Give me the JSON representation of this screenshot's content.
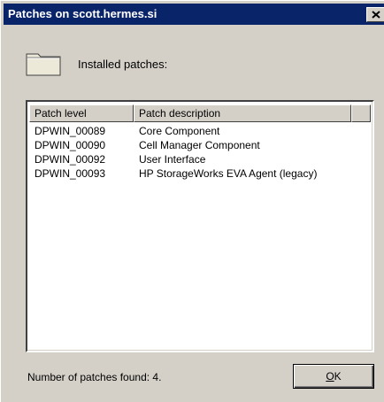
{
  "window": {
    "title": "Patches on scott.hermes.si"
  },
  "header": {
    "icon": "folder-icon",
    "label": "Installed patches:"
  },
  "table": {
    "columns": [
      "Patch level",
      "Patch description"
    ],
    "rows": [
      {
        "level": "DPWIN_00089",
        "description": "Core Component"
      },
      {
        "level": "DPWIN_00090",
        "description": "Cell Manager Component"
      },
      {
        "level": "DPWIN_00092",
        "description": "User Interface"
      },
      {
        "level": "DPWIN_00093",
        "description": "HP StorageWorks EVA Agent (legacy)"
      }
    ]
  },
  "footer": {
    "count_text": "Number of patches found: 4.",
    "ok_mnemonic": "O",
    "ok_rest": "K"
  },
  "colors": {
    "title_bar": "#0a246a",
    "dialog_face": "#d4d0c8",
    "list_background": "#ffffff"
  }
}
